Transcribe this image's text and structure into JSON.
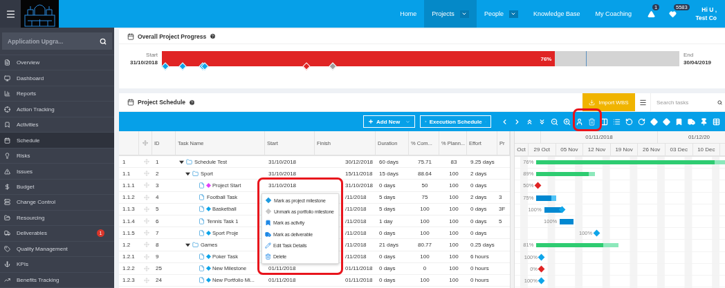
{
  "topbar": {
    "nav": [
      {
        "label": "Home",
        "selected": false,
        "dropdown": false
      },
      {
        "label": "Projects",
        "selected": true,
        "dropdown": true
      },
      {
        "label": "People",
        "selected": false,
        "dropdown": true
      },
      {
        "label": "Knowledge Base",
        "selected": false,
        "dropdown": false
      },
      {
        "label": "My Coaching",
        "selected": false,
        "dropdown": false
      }
    ],
    "alerts_badge": "1",
    "points_badge": "5583",
    "greeting": "Hi U ,",
    "company": "Test Co"
  },
  "sidebar": {
    "search_value": "Application Upgra...",
    "items": [
      {
        "label": "Overview",
        "selected": false
      },
      {
        "label": "Dashboard",
        "selected": false
      },
      {
        "label": "Reports",
        "selected": false
      },
      {
        "label": "Action Tracking",
        "selected": false
      },
      {
        "label": "Activities",
        "selected": false
      },
      {
        "label": "Schedule",
        "selected": true
      },
      {
        "label": "Risks",
        "selected": false
      },
      {
        "label": "Issues",
        "selected": false
      },
      {
        "label": "Budget",
        "selected": false
      },
      {
        "label": "Change Control",
        "selected": false
      },
      {
        "label": "Resourcing",
        "selected": false
      },
      {
        "label": "Deliverables",
        "selected": false,
        "badge": "1"
      },
      {
        "label": "Quality Management",
        "selected": false
      },
      {
        "label": "KPIs",
        "selected": false
      },
      {
        "label": "Benefits Tracking",
        "selected": false
      }
    ]
  },
  "progress": {
    "title": "Overall Project Progress",
    "start_label": "Start",
    "start_date": "31/10/2018",
    "end_label": "End",
    "end_date": "30/04/2019",
    "level": 0.76,
    "percent": "76%",
    "milestones": [
      {
        "color": "#0ea5e9",
        "level": 0.007
      },
      {
        "color": "#0ea5e9",
        "level": 0.04
      },
      {
        "color": "#0ea5e9",
        "level": 0.079
      },
      {
        "color": "#0ea5e9",
        "level": 0.083
      },
      {
        "color": "#e02424",
        "level": 0.28
      },
      {
        "color": "#9e9e9e",
        "level": 0.33
      }
    ]
  },
  "schedule": {
    "title": "Project Schedule",
    "import_button": "Import WBS",
    "search_placeholder": "Search tasks",
    "add_button": "Add New",
    "execution_button": "Execution Schedule",
    "columns": [
      "ID",
      "Task Name",
      "Start",
      "Finish",
      "Duration",
      "% Com...",
      "% Plann...",
      "Effort",
      "Pr"
    ],
    "timeline": {
      "months": [
        "01/11/2018",
        "01/12/20"
      ],
      "weeks": [
        "Oct",
        "29 Oct",
        "05 Nov",
        "12 Nov",
        "19 Nov",
        "26 Nov",
        "03 Dec",
        "10 Dec"
      ]
    },
    "rows": [
      {
        "wbs": "1",
        "id": "1",
        "name": "Schedule Test",
        "kind": "folder",
        "expanded": true,
        "start": "31/10/2018",
        "finish": "30/12/2018",
        "duration": "60 days",
        "complete": "75.71",
        "planned": "83",
        "effort": "9.25 days",
        "bar": {
          "kind": "summary",
          "label": "76%",
          "level": 0.76
        },
        "children": [
          {
            "wbs": "1.1",
            "id": "2",
            "name": "Sport",
            "kind": "folder",
            "expanded": true,
            "start": "31/10/2018",
            "finish": "15/11/2018",
            "duration": "15 days",
            "complete": "88.64",
            "planned": "100",
            "effort": "2 days",
            "bar": {
              "kind": "summary",
              "label": "89%",
              "level": 0.89
            },
            "children": [
              {
                "wbs": "1.1.1",
                "id": "3",
                "name": "Project Start",
                "kind": "file",
                "color": "#e040fb",
                "start": "31/10/2018",
                "finish": "31/10/2018",
                "duration": "0 days",
                "complete": "50",
                "planned": "100",
                "effort": "0 days",
                "bar": {
                  "kind": "milestone",
                  "label": "50%",
                  "color": "#e02424"
                }
              },
              {
                "wbs": "1.1.2",
                "id": "4",
                "name": "Football Task",
                "kind": "file",
                "finish": "/11/2018",
                "duration": "5 days",
                "complete": "75",
                "planned": "100",
                "effort": "2 days",
                "pr": "3",
                "bar": {
                  "kind": "task",
                  "label": "75%",
                  "level": 0.75
                }
              },
              {
                "wbs": "1.1.3",
                "id": "5",
                "name": "Basketball",
                "kind": "file",
                "color": "#0ea5e9",
                "finish": "/11/2018",
                "duration": "5 days",
                "complete": "100",
                "planned": "100",
                "effort": "0 days",
                "pr": "3F",
                "bar": {
                  "kind": "task",
                  "label": "100%",
                  "level": 1
                }
              },
              {
                "wbs": "1.1.4",
                "id": "6",
                "name": "Tennis Task 1",
                "kind": "file",
                "finish": "/11/2018",
                "duration": "1 day",
                "complete": "100",
                "planned": "100",
                "effort": "0 days",
                "pr": "5",
                "bar": {
                  "kind": "task",
                  "label": "100%",
                  "level": 1
                }
              },
              {
                "wbs": "1.1.5",
                "id": "7",
                "name": "Sport Proje",
                "kind": "file",
                "color": "#0ea5e9",
                "finish": "/11/2018",
                "duration": "0 days",
                "complete": "100",
                "planned": "100",
                "effort": "0 days",
                "bar": {
                  "kind": "milestone",
                  "label": "100%",
                  "color": "#0ea5e9"
                }
              }
            ]
          },
          {
            "wbs": "1.2",
            "id": "8",
            "name": "Games",
            "kind": "folder",
            "expanded": true,
            "finish": "/11/2018",
            "duration": "21 days",
            "complete": "80.77",
            "planned": "100",
            "effort": "0.25 days",
            "bar": {
              "kind": "summary",
              "label": "81%",
              "level": 0.81
            },
            "children": [
              {
                "wbs": "1.2.1",
                "id": "9",
                "name": "Poker Task",
                "kind": "file",
                "color": "#0ea5e9",
                "finish": "/11/2018",
                "duration": "0 days",
                "complete": "100",
                "planned": "100",
                "effort": "6 hours",
                "bar": {
                  "kind": "milestone",
                  "label": "100%",
                  "color": "#0ea5e9"
                }
              },
              {
                "wbs": "1.2.2",
                "id": "25",
                "name": "New Milestone",
                "kind": "file",
                "color": "#0ea5e9",
                "start": "01/11/2018",
                "finish": "01/11/2018",
                "duration": "0 days",
                "complete": "0",
                "planned": "100",
                "effort": "0 hours",
                "bar": {
                  "kind": "milestone",
                  "label": "0%",
                  "color": "#e02424"
                }
              },
              {
                "wbs": "1.2.3",
                "id": "24",
                "name": "New Portfolio Mi...",
                "kind": "file",
                "color": "#0ea5e9",
                "start": "01/11/2018",
                "finish": "01/11/2018",
                "duration": "0 days",
                "complete": "100",
                "planned": "100",
                "effort": "0 hours",
                "bar": {
                  "kind": "milestone",
                  "label": "100%",
                  "color": "#0ea5e9"
                }
              }
            ]
          }
        ]
      }
    ],
    "context_menu": [
      {
        "label": "Mark as project milestone"
      },
      {
        "label": "Unmark as portfolio milestone"
      },
      {
        "label": "Mark as activity"
      },
      {
        "label": "Mark as deliverable"
      },
      {
        "label": "Edit Task Details"
      },
      {
        "label": "Delete"
      }
    ]
  }
}
